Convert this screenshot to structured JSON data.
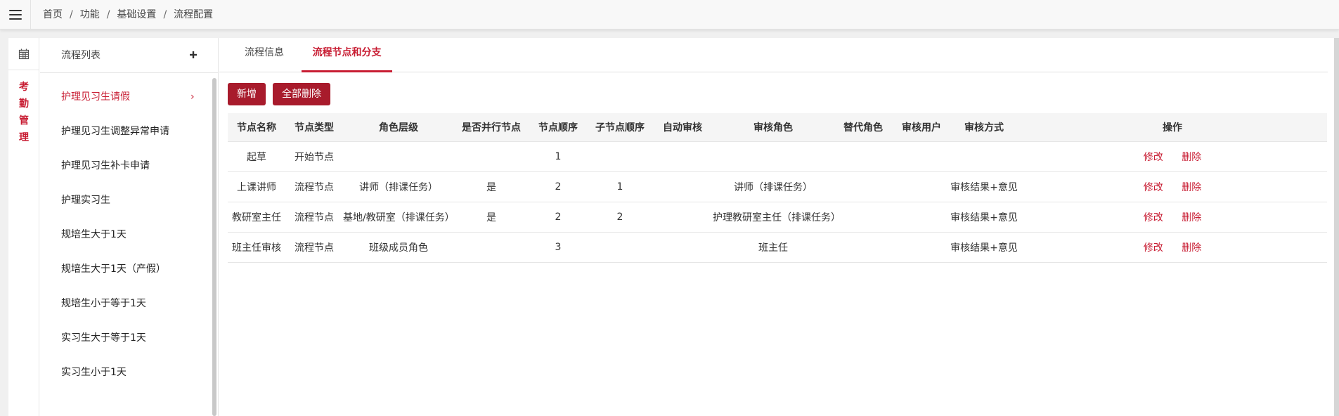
{
  "breadcrumb": [
    "首页",
    "功能",
    "基础设置",
    "流程配置"
  ],
  "rail": {
    "label_chars": [
      "考",
      "勤",
      "管",
      "理"
    ]
  },
  "flow_list": {
    "title": "流程列表",
    "items": [
      {
        "label": "护理见习生请假",
        "active": true
      },
      {
        "label": "护理见习生调整异常申请"
      },
      {
        "label": "护理见习生补卡申请"
      },
      {
        "label": "护理实习生"
      },
      {
        "label": "规培生大于1天"
      },
      {
        "label": "规培生大于1天（产假）"
      },
      {
        "label": "规培生小于等于1天"
      },
      {
        "label": "实习生大于等于1天"
      },
      {
        "label": "实习生小于1天"
      }
    ]
  },
  "tabs": [
    {
      "label": "流程信息"
    },
    {
      "label": "流程节点和分支",
      "active": true
    }
  ],
  "toolbar": {
    "add_label": "新增",
    "delete_all_label": "全部删除"
  },
  "table": {
    "columns": [
      "节点名称",
      "节点类型",
      "角色层级",
      "是否并行节点",
      "节点顺序",
      "子节点顺序",
      "自动审核",
      "审核角色",
      "替代角色",
      "审核用户",
      "审核方式",
      "操作"
    ],
    "rows": [
      {
        "name": "起草",
        "type": "开始节点",
        "role_level": "",
        "parallel": "",
        "order": "1",
        "sub_order": "",
        "auto": "",
        "review_role": "",
        "alt_role": "",
        "review_user": "",
        "method": ""
      },
      {
        "name": "上课讲师",
        "type": "流程节点",
        "role_level": "讲师（排课任务）",
        "parallel": "是",
        "order": "2",
        "sub_order": "1",
        "auto": "",
        "review_role": "讲师（排课任务）",
        "alt_role": "",
        "review_user": "",
        "method": "审核结果+意见"
      },
      {
        "name": "教研室主任",
        "type": "流程节点",
        "role_level": "基地/教研室（排课任务）",
        "parallel": "是",
        "order": "2",
        "sub_order": "2",
        "auto": "",
        "review_role": "护理教研室主任（排课任务）",
        "alt_role": "",
        "review_user": "",
        "method": "审核结果+意见"
      },
      {
        "name": "班主任审核",
        "type": "流程节点",
        "role_level": "班级成员角色",
        "parallel": "",
        "order": "3",
        "sub_order": "",
        "auto": "",
        "review_role": "班主任",
        "alt_role": "",
        "review_user": "",
        "method": "审核结果+意见"
      }
    ],
    "edit_label": "修改",
    "delete_label": "删除"
  },
  "colors": {
    "accent": "#c81d33",
    "button": "#a81b2c"
  },
  "icons": [
    "menu-icon",
    "calendar-icon",
    "plus-icon",
    "chevron-right-icon"
  ]
}
